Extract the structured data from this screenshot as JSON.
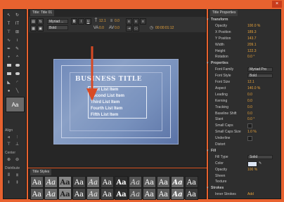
{
  "window": {
    "close_label": "×"
  },
  "title_panel": {
    "tab": "Title: Title 01",
    "font_family": "Myriad ...",
    "font_style": "Bold",
    "font_size": "12.1",
    "kerning": "0.0",
    "leading": "0.0",
    "tracking": "0.0",
    "timecode": "00:00:01:12",
    "canvas": {
      "title": "Business Title",
      "items": [
        "First List Item",
        "Second List Item",
        "Third List Item",
        "Fourth List Item",
        "Fifth List Item"
      ]
    }
  },
  "tools": {
    "labels": {
      "align": "Align",
      "center": "Center",
      "distribute": "Distribute"
    },
    "thumb_label": "Aa"
  },
  "styles_panel": {
    "tab": "Title Styles",
    "samples": [
      "Aa",
      "Aa",
      "Aa",
      "Aa",
      "Aa",
      "Aa",
      "Aa",
      "Aa",
      "Aa",
      "Aa",
      "Aa",
      "Aa",
      "Aa",
      "Aa",
      "Aa",
      "Aa",
      "Aa",
      "Aa",
      "Aa",
      "Aa",
      "Aa",
      "Aa",
      "Aa",
      "Aa"
    ]
  },
  "properties": {
    "tab": "Title Properties",
    "rows": [
      {
        "label": "Transform",
        "value": "",
        "head": true
      },
      {
        "label": "Opacity",
        "value": "100.0 %"
      },
      {
        "label": "X Position",
        "value": "189.3"
      },
      {
        "label": "Y Position",
        "value": "143.7"
      },
      {
        "label": "Width",
        "value": "209.1"
      },
      {
        "label": "Height",
        "value": "122.3"
      },
      {
        "label": "Rotation",
        "value": "0.0 °"
      },
      {
        "label": "Properties",
        "value": "",
        "head": true
      },
      {
        "label": "Font Family",
        "value": "Myriad Pro"
      },
      {
        "label": "Font Style",
        "value": "Bold"
      },
      {
        "label": "Font Size",
        "value": "12.1"
      },
      {
        "label": "Aspect",
        "value": "140.0 %"
      },
      {
        "label": "Leading",
        "value": "0.0"
      },
      {
        "label": "Kerning",
        "value": "0.0"
      },
      {
        "label": "Tracking",
        "value": "0.0"
      },
      {
        "label": "Baseline Shift",
        "value": "0.0"
      },
      {
        "label": "Slant",
        "value": "0.0 °"
      },
      {
        "label": "Small Caps",
        "value": ""
      },
      {
        "label": "Small Caps Size",
        "value": "1.0 %"
      },
      {
        "label": "Underline",
        "value": ""
      },
      {
        "label": "Distort",
        "value": ""
      },
      {
        "label": "Fill",
        "value": "",
        "head": true
      },
      {
        "label": "Fill Type",
        "value": "Solid"
      },
      {
        "label": "Color",
        "value": ""
      },
      {
        "label": "Opacity",
        "value": "100 %"
      },
      {
        "label": "Sheen",
        "value": ""
      },
      {
        "label": "Texture",
        "value": ""
      },
      {
        "label": "Strokes",
        "value": "",
        "head": true
      },
      {
        "label": "Inner Strokes",
        "value": "Add"
      }
    ]
  }
}
